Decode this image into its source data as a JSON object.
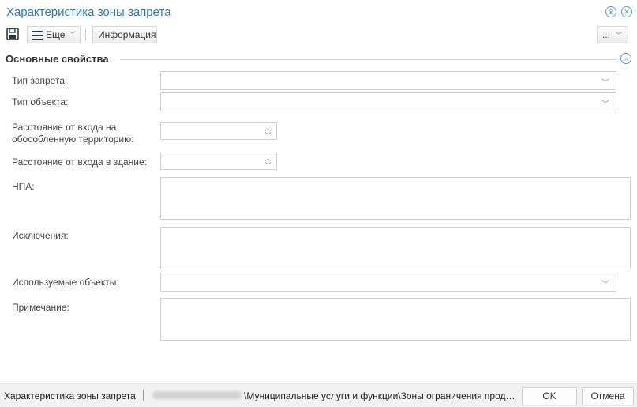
{
  "window": {
    "title": "Характеристика зоны запрета"
  },
  "toolbar": {
    "more_label": "Еще",
    "info_label": "Информация",
    "overflow_label": "..."
  },
  "section": {
    "title": "Основные свойства"
  },
  "fields": {
    "ban_type": {
      "label": "Тип запрета:",
      "value": ""
    },
    "object_type": {
      "label": "Тип объекта:",
      "value": ""
    },
    "distance_territory": {
      "label": "Расстояние от входа на обособленную территорию:",
      "value": ""
    },
    "distance_building": {
      "label": "Расстояние от входа в здание:",
      "value": ""
    },
    "npa": {
      "label": "НПА:",
      "value": ""
    },
    "exceptions": {
      "label": "Исключения:",
      "value": ""
    },
    "used_objects": {
      "label": "Используемые объекты:",
      "value": ""
    },
    "note": {
      "label": "Примечание:",
      "value": ""
    }
  },
  "statusbar": {
    "form_name": "Характеристика зоны запрета",
    "path": "\\Муниципальные услуги и функции\\Зоны ограничения прод…",
    "ok_label": "OK",
    "cancel_label": "Отмена"
  },
  "colors": {
    "accent": "#2a7ab8",
    "icon_blue": "#5b9bd5"
  }
}
